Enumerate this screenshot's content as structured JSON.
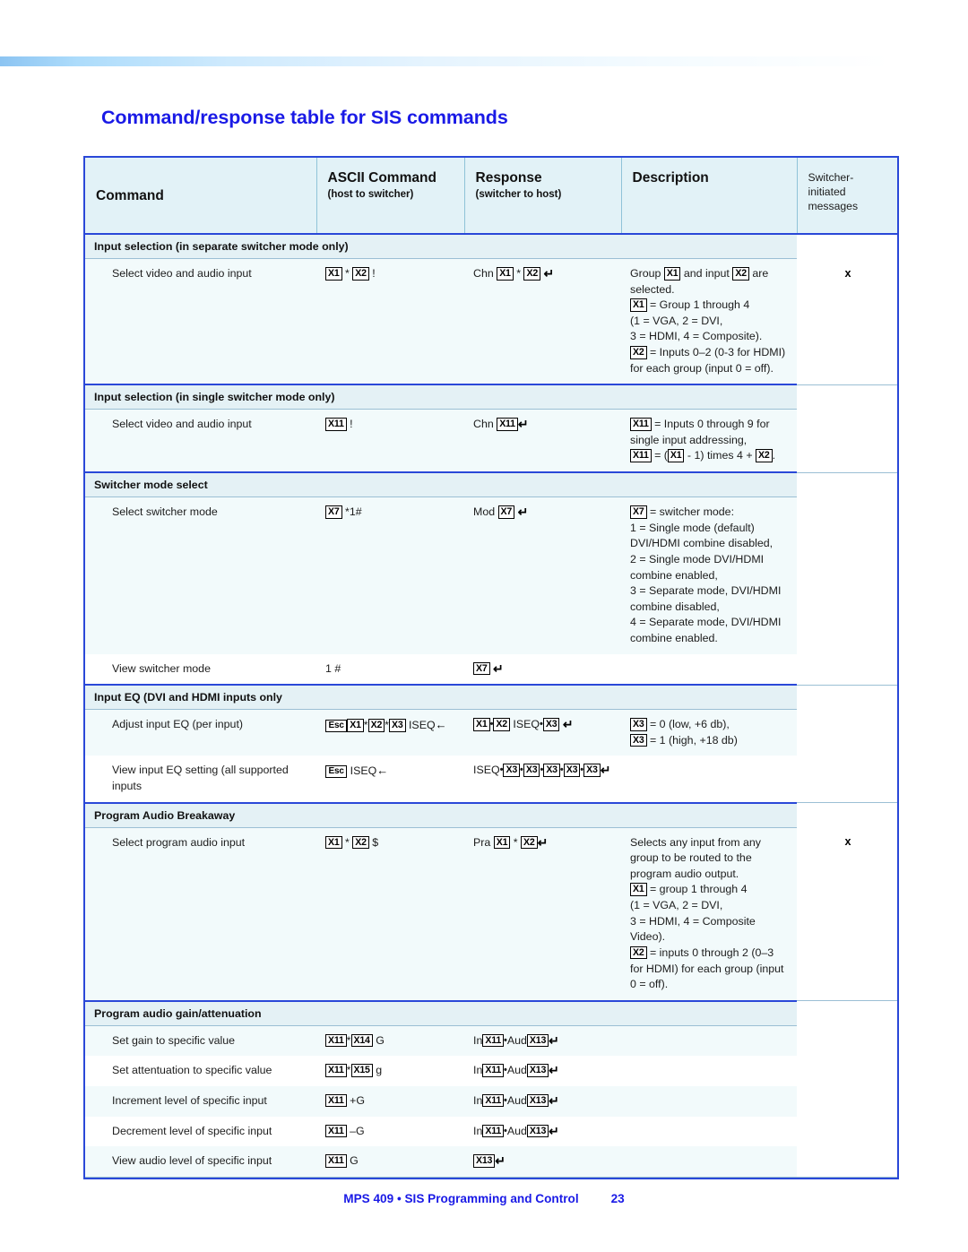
{
  "page": {
    "title": "Command/response table for SIS commands",
    "footer_text": "MPS 409 • SIS Programming and Control",
    "footer_page_number": "23",
    "accent_color": "#1a1ae6",
    "table_border_color": "#2a48d8",
    "header_bg": "#e2f2f7",
    "row_bg": "#f2fafb"
  },
  "table": {
    "headers": {
      "command": "Command",
      "ascii_main": "ASCII Command",
      "ascii_sub": "(host to switcher)",
      "response_main": "Response",
      "response_sub": "(switcher to host)",
      "description": "Description",
      "switcher_initiated": "Switcher-initiated messages"
    },
    "sections": [
      {
        "title": "Input selection (in separate switcher mode only)",
        "rows": [
          {
            "command": "Select video and audio input",
            "ascii": [
              {
                "t": "box",
                "v": "X1"
              },
              {
                "t": "txt",
                "v": " * "
              },
              {
                "t": "box",
                "v": "X2"
              },
              {
                "t": "txt",
                "v": " !"
              }
            ],
            "response": [
              {
                "t": "txt",
                "v": "Chn "
              },
              {
                "t": "box",
                "v": "X1"
              },
              {
                "t": "txt",
                "v": " * "
              },
              {
                "t": "box",
                "v": "X2"
              },
              {
                "t": "txt",
                "v": "  "
              },
              {
                "t": "ret",
                "v": "↵"
              }
            ],
            "description": [
              [
                {
                  "t": "txt",
                  "v": "Group "
                },
                {
                  "t": "box",
                  "v": "X1"
                },
                {
                  "t": "txt",
                  "v": " and input "
                },
                {
                  "t": "box",
                  "v": "X2"
                },
                {
                  "t": "txt",
                  "v": " are"
                }
              ],
              [
                {
                  "t": "txt",
                  "v": "selected."
                }
              ],
              [
                {
                  "t": "box",
                  "v": "X1"
                },
                {
                  "t": "txt",
                  "v": " = Group 1 through 4"
                }
              ],
              [
                {
                  "t": "txt",
                  "v": "(1 = VGA, 2 = DVI,"
                }
              ],
              [
                {
                  "t": "txt",
                  "v": "3 = HDMI, 4 = Composite)."
                }
              ],
              [
                {
                  "t": "box",
                  "v": "X2"
                },
                {
                  "t": "txt",
                  "v": " = Inputs 0–2 (0-3 for HDMI)"
                }
              ],
              [
                {
                  "t": "txt",
                  "v": "for each group (input 0 = off)."
                }
              ]
            ],
            "switcher_initiated": "x"
          }
        ]
      },
      {
        "title": "Input selection (in single switcher mode only)",
        "rows": [
          {
            "command": "Select video and audio input",
            "ascii": [
              {
                "t": "box",
                "v": "X11"
              },
              {
                "t": "txt",
                "v": " !"
              }
            ],
            "response": [
              {
                "t": "txt",
                "v": "Chn "
              },
              {
                "t": "box",
                "v": "X11"
              },
              {
                "t": "ret",
                "v": "↵"
              }
            ],
            "description": [
              [
                {
                  "t": "box",
                  "v": "X11"
                },
                {
                  "t": "txt",
                  "v": " = Inputs 0 through 9 for"
                }
              ],
              [
                {
                  "t": "txt",
                  "v": "single input addressing,"
                }
              ],
              [
                {
                  "t": "box",
                  "v": "X11"
                },
                {
                  "t": "txt",
                  "v": " = ("
                },
                {
                  "t": "box",
                  "v": "X1"
                },
                {
                  "t": "txt",
                  "v": " - 1) times 4 + "
                },
                {
                  "t": "box",
                  "v": "X2"
                },
                {
                  "t": "txt",
                  "v": "."
                }
              ]
            ],
            "switcher_initiated": ""
          }
        ]
      },
      {
        "title": "Switcher mode select",
        "rows": [
          {
            "command": "Select switcher mode",
            "ascii": [
              {
                "t": "box",
                "v": "X7"
              },
              {
                "t": "txt",
                "v": " *1#"
              }
            ],
            "response": [
              {
                "t": "txt",
                "v": "Mod "
              },
              {
                "t": "box",
                "v": "X7"
              },
              {
                "t": "txt",
                "v": " "
              },
              {
                "t": "ret",
                "v": "↵"
              }
            ],
            "description": [
              [
                {
                  "t": "box",
                  "v": "X7"
                },
                {
                  "t": "txt",
                  "v": " = switcher mode:"
                }
              ],
              [
                {
                  "t": "txt",
                  "v": "1 = Single mode (default)"
                }
              ],
              [
                {
                  "t": "txt",
                  "v": "DVI/HDMI combine disabled,"
                }
              ],
              [
                {
                  "t": "txt",
                  "v": "2 = Single mode DVI/HDMI"
                }
              ],
              [
                {
                  "t": "txt",
                  "v": "combine enabled,"
                }
              ],
              [
                {
                  "t": "txt",
                  "v": "3 = Separate mode, DVI/HDMI"
                }
              ],
              [
                {
                  "t": "txt",
                  "v": "combine disabled,"
                }
              ],
              [
                {
                  "t": "txt",
                  "v": "4 = Separate mode, DVI/HDMI"
                }
              ],
              [
                {
                  "t": "txt",
                  "v": "combine enabled."
                }
              ]
            ],
            "switcher_initiated": ""
          },
          {
            "command": "View switcher mode",
            "ascii": [
              {
                "t": "txt",
                "v": "1 #"
              }
            ],
            "response": [
              {
                "t": "box",
                "v": "X7"
              },
              {
                "t": "txt",
                "v": " "
              },
              {
                "t": "ret",
                "v": "↵"
              }
            ],
            "description": [],
            "switcher_initiated": ""
          }
        ]
      },
      {
        "title": "Input EQ (DVI and HDMI inputs only",
        "rows": [
          {
            "command": "Adjust input EQ (per input)",
            "ascii": [
              {
                "t": "box",
                "v": "Esc",
                "esc": true
              },
              {
                "t": "box",
                "v": "X1"
              },
              {
                "t": "txt",
                "v": "*"
              },
              {
                "t": "box",
                "v": "X2"
              },
              {
                "t": "txt",
                "v": "*"
              },
              {
                "t": "box",
                "v": "X3"
              },
              {
                "t": "txt",
                "v": " ISEQ"
              },
              {
                "t": "larr",
                "v": "←"
              }
            ],
            "response": [
              {
                "t": "box",
                "v": "X1"
              },
              {
                "t": "bull",
                "v": "•"
              },
              {
                "t": "box",
                "v": "X2"
              },
              {
                "t": "txt",
                "v": " ISEQ"
              },
              {
                "t": "bull",
                "v": "•"
              },
              {
                "t": "box",
                "v": "X3"
              },
              {
                "t": "txt",
                "v": "  "
              },
              {
                "t": "ret",
                "v": "↵"
              }
            ],
            "description": [
              [
                {
                  "t": "box",
                  "v": "X3"
                },
                {
                  "t": "txt",
                  "v": " = 0 (low, +6 db),"
                }
              ],
              [
                {
                  "t": "box",
                  "v": "X3"
                },
                {
                  "t": "txt",
                  "v": " = 1 (high, +18 db)"
                }
              ]
            ],
            "switcher_initiated": ""
          },
          {
            "command": "View input EQ setting (all supported inputs",
            "ascii": [
              {
                "t": "box",
                "v": "Esc",
                "esc": true
              },
              {
                "t": "txt",
                "v": "  ISEQ"
              },
              {
                "t": "larr",
                "v": "←"
              }
            ],
            "response": [
              {
                "t": "txt",
                "v": "ISEQ"
              },
              {
                "t": "bull",
                "v": "•"
              },
              {
                "t": "box",
                "v": "X3"
              },
              {
                "t": "bull",
                "v": "•"
              },
              {
                "t": "box",
                "v": "X3"
              },
              {
                "t": "bull",
                "v": "•"
              },
              {
                "t": "box",
                "v": "X3"
              },
              {
                "t": "bull",
                "v": "•"
              },
              {
                "t": "box",
                "v": "X3"
              },
              {
                "t": "bull",
                "v": "•"
              },
              {
                "t": "box",
                "v": "X3"
              },
              {
                "t": "ret",
                "v": "↵"
              }
            ],
            "description": [],
            "switcher_initiated": ""
          }
        ]
      },
      {
        "title": "Program Audio Breakaway",
        "rows": [
          {
            "command": "Select program audio input",
            "ascii": [
              {
                "t": "box",
                "v": "X1"
              },
              {
                "t": "txt",
                "v": " * "
              },
              {
                "t": "box",
                "v": "X2"
              },
              {
                "t": "txt",
                "v": " $"
              }
            ],
            "response": [
              {
                "t": "txt",
                "v": "Pra "
              },
              {
                "t": "box",
                "v": "X1"
              },
              {
                "t": "txt",
                "v": " * "
              },
              {
                "t": "box",
                "v": "X2"
              },
              {
                "t": "ret",
                "v": "↵"
              }
            ],
            "description": [
              [
                {
                  "t": "txt",
                  "v": "Selects any input from any"
                }
              ],
              [
                {
                  "t": "txt",
                  "v": "group to be routed to the"
                }
              ],
              [
                {
                  "t": "txt",
                  "v": "program audio output."
                }
              ],
              [
                {
                  "t": "box",
                  "v": "X1"
                },
                {
                  "t": "txt",
                  "v": " = group 1 through 4"
                }
              ],
              [
                {
                  "t": "txt",
                  "v": "(1 = VGA, 2 = DVI,"
                }
              ],
              [
                {
                  "t": "txt",
                  "v": "3 = HDMI, 4 = Composite"
                }
              ],
              [
                {
                  "t": "txt",
                  "v": "Video)."
                }
              ],
              [
                {
                  "t": "box",
                  "v": "X2"
                },
                {
                  "t": "txt",
                  "v": " = inputs 0 through 2 (0–3"
                }
              ],
              [
                {
                  "t": "txt",
                  "v": "for HDMI) for each group (input"
                }
              ],
              [
                {
                  "t": "txt",
                  "v": "0 = off)."
                }
              ]
            ],
            "switcher_initiated": "x"
          }
        ]
      },
      {
        "title": "Program audio gain/attenuation",
        "rows": [
          {
            "command": "Set gain to specific value",
            "ascii": [
              {
                "t": "box",
                "v": "X11"
              },
              {
                "t": "txt",
                "v": "*"
              },
              {
                "t": "box",
                "v": "X14"
              },
              {
                "t": "txt",
                "v": "  G"
              }
            ],
            "response": [
              {
                "t": "txt",
                "v": "In"
              },
              {
                "t": "box",
                "v": "X11"
              },
              {
                "t": "bull",
                "v": "•"
              },
              {
                "t": "txt",
                "v": "Aud"
              },
              {
                "t": "box",
                "v": "X13"
              },
              {
                "t": "ret",
                "v": "↵"
              }
            ],
            "description": [],
            "switcher_initiated": ""
          },
          {
            "command": "Set attentuation to specific value",
            "ascii": [
              {
                "t": "box",
                "v": "X11"
              },
              {
                "t": "txt",
                "v": "*"
              },
              {
                "t": "box",
                "v": "X15"
              },
              {
                "t": "txt",
                "v": "  g"
              }
            ],
            "response": [
              {
                "t": "txt",
                "v": "In"
              },
              {
                "t": "box",
                "v": "X11"
              },
              {
                "t": "bull",
                "v": "•"
              },
              {
                "t": "txt",
                "v": "Aud"
              },
              {
                "t": "box",
                "v": "X13"
              },
              {
                "t": "ret",
                "v": "↵"
              }
            ],
            "description": [],
            "switcher_initiated": ""
          },
          {
            "command": "Increment level of specific input",
            "ascii": [
              {
                "t": "box",
                "v": "X11"
              },
              {
                "t": "txt",
                "v": "  +G"
              }
            ],
            "response": [
              {
                "t": "txt",
                "v": "In"
              },
              {
                "t": "box",
                "v": "X11"
              },
              {
                "t": "bull",
                "v": "•"
              },
              {
                "t": "txt",
                "v": "Aud"
              },
              {
                "t": "box",
                "v": "X13"
              },
              {
                "t": "ret",
                "v": "↵"
              }
            ],
            "description": [],
            "switcher_initiated": ""
          },
          {
            "command": "Decrement level of specific input",
            "ascii": [
              {
                "t": "box",
                "v": "X11"
              },
              {
                "t": "txt",
                "v": "  –G"
              }
            ],
            "response": [
              {
                "t": "txt",
                "v": "In"
              },
              {
                "t": "box",
                "v": "X11"
              },
              {
                "t": "bull",
                "v": "•"
              },
              {
                "t": "txt",
                "v": "Aud"
              },
              {
                "t": "box",
                "v": "X13"
              },
              {
                "t": "ret",
                "v": "↵"
              }
            ],
            "description": [],
            "switcher_initiated": ""
          },
          {
            "command": "View audio level of specific input",
            "ascii": [
              {
                "t": "box",
                "v": "X11"
              },
              {
                "t": "txt",
                "v": "  G"
              }
            ],
            "response": [
              {
                "t": "box",
                "v": "X13"
              },
              {
                "t": "ret",
                "v": "↵"
              }
            ],
            "description": [],
            "switcher_initiated": ""
          }
        ]
      }
    ]
  }
}
